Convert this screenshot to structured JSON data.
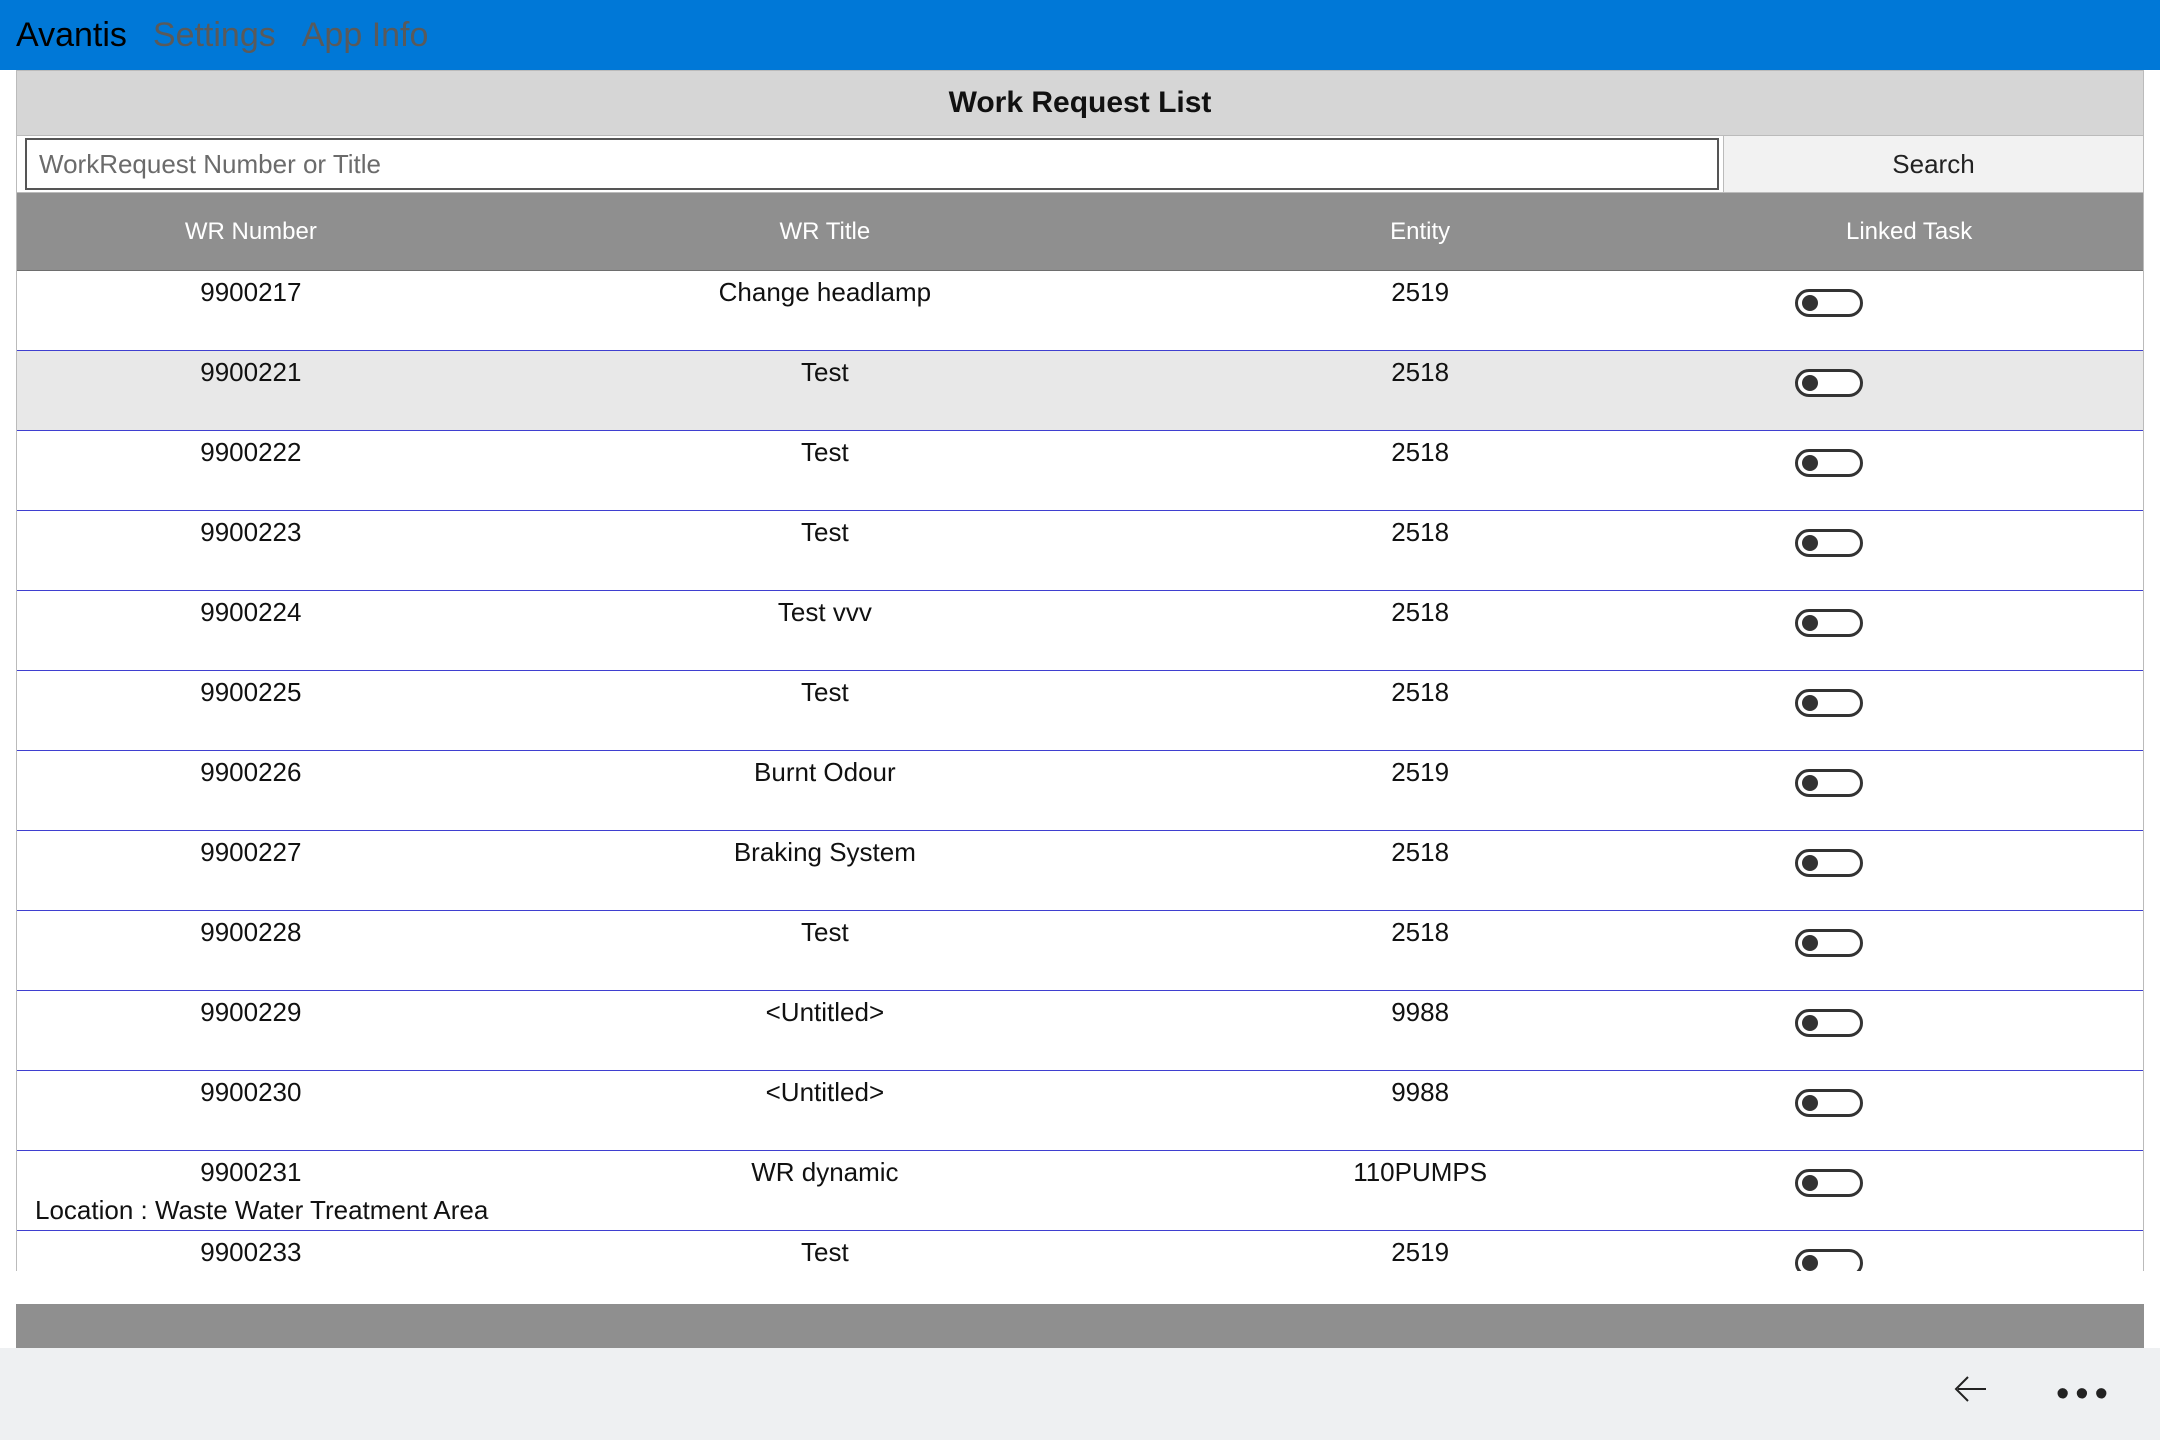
{
  "menu": {
    "avantis": "Avantis",
    "settings": "Settings",
    "appinfo": "App Info"
  },
  "header": {
    "title": "Work Request List"
  },
  "search": {
    "placeholder": "WorkRequest Number or Title",
    "button": "Search"
  },
  "columns": {
    "wr_number": "WR Number",
    "wr_title": "WR Title",
    "entity": "Entity",
    "linked_task": "Linked Task"
  },
  "rows": [
    {
      "number": "9900217",
      "title": "Change headlamp",
      "entity": "2519",
      "linked": false,
      "selected": false
    },
    {
      "number": "9900221",
      "title": "Test",
      "entity": "2518",
      "linked": false,
      "selected": true
    },
    {
      "number": "9900222",
      "title": "Test",
      "entity": "2518",
      "linked": false,
      "selected": false
    },
    {
      "number": "9900223",
      "title": "Test",
      "entity": "2518",
      "linked": false,
      "selected": false
    },
    {
      "number": "9900224",
      "title": "Test vvv",
      "entity": "2518",
      "linked": false,
      "selected": false
    },
    {
      "number": "9900225",
      "title": "Test",
      "entity": "2518",
      "linked": false,
      "selected": false
    },
    {
      "number": "9900226",
      "title": "Burnt Odour",
      "entity": "2519",
      "linked": false,
      "selected": false
    },
    {
      "number": "9900227",
      "title": "Braking System",
      "entity": "2518",
      "linked": false,
      "selected": false
    },
    {
      "number": "9900228",
      "title": "Test",
      "entity": "2518",
      "linked": false,
      "selected": false
    },
    {
      "number": "9900229",
      "title": "<Untitled>",
      "entity": "9988",
      "linked": false,
      "selected": false
    },
    {
      "number": "9900230",
      "title": "<Untitled>",
      "entity": "9988",
      "linked": false,
      "selected": false
    },
    {
      "number": "9900231",
      "title": "WR dynamic",
      "entity": "110PUMPS",
      "linked": false,
      "selected": false,
      "subtext": "Location : Waste Water Treatment Area"
    },
    {
      "number": "9900233",
      "title": "Test",
      "entity": "2519",
      "linked": false,
      "selected": false
    }
  ]
}
